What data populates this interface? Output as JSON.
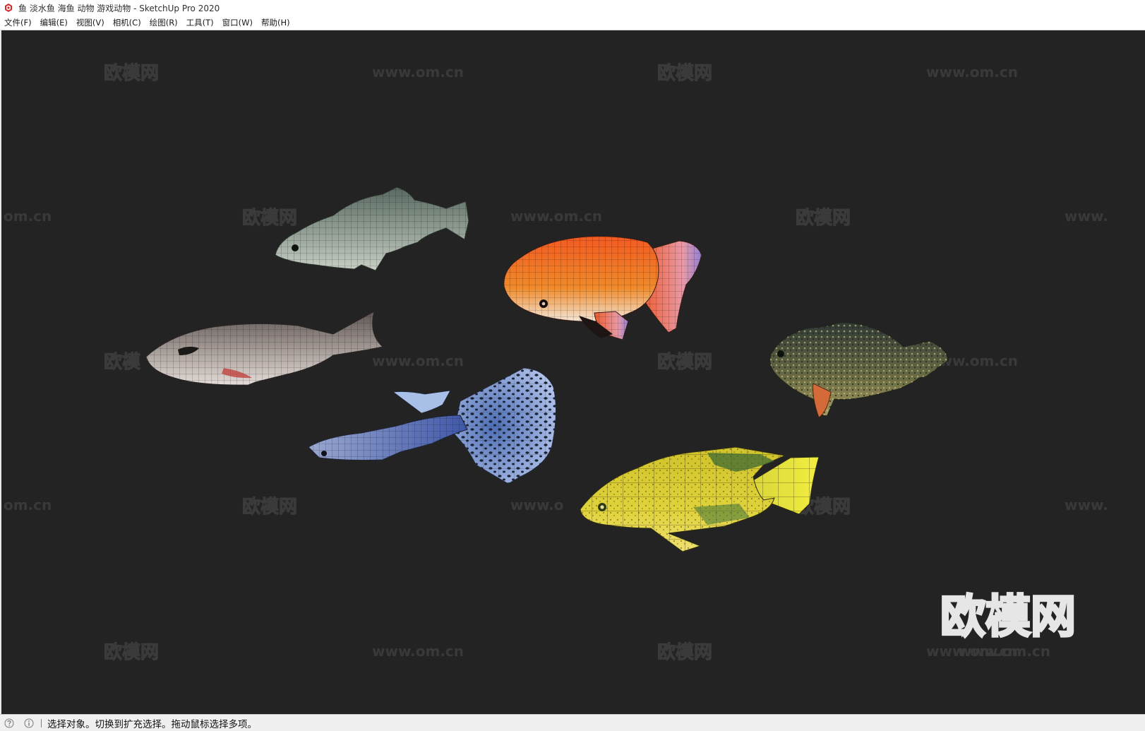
{
  "window": {
    "title": "鱼 淡水鱼 海鱼 动物 游戏动物 - SketchUp Pro 2020",
    "app_icon": "sketchup-logo-icon"
  },
  "menubar": {
    "items": [
      {
        "label": "文件(F)"
      },
      {
        "label": "编辑(E)"
      },
      {
        "label": "视图(V)"
      },
      {
        "label": "相机(C)"
      },
      {
        "label": "绘图(R)"
      },
      {
        "label": "工具(T)"
      },
      {
        "label": "窗口(W)"
      },
      {
        "label": "帮助(H)"
      }
    ]
  },
  "watermark": {
    "logo": "欧模网",
    "url": "www.om.cn",
    "partial_url_left": "om.cn",
    "partial_url_right": "www.",
    "partial_url_mid": "www.o",
    "partial_logo": "欧模"
  },
  "big_watermark": {
    "logo": "欧模网",
    "url": "www.om.cn"
  },
  "model": {
    "fish": [
      {
        "name": "green-gray freshwater fish",
        "color": "#7e8a80"
      },
      {
        "name": "red ranchu goldfish",
        "color": "#e8421c"
      },
      {
        "name": "gray saltwater fish",
        "color": "#9a8d89"
      },
      {
        "name": "spotted sunfish",
        "color": "#5e6a4a"
      },
      {
        "name": "blue guppy",
        "color": "#6f90c8"
      },
      {
        "name": "yellow cichlid",
        "color": "#d9c82c"
      }
    ]
  },
  "statusbar": {
    "icons": [
      "help-icon",
      "info-icon"
    ],
    "message": "选择对象。切换到扩充选择。拖动鼠标选择多项。"
  },
  "colors": {
    "viewport_bg": "#232323",
    "accent": "#d62a2a"
  }
}
